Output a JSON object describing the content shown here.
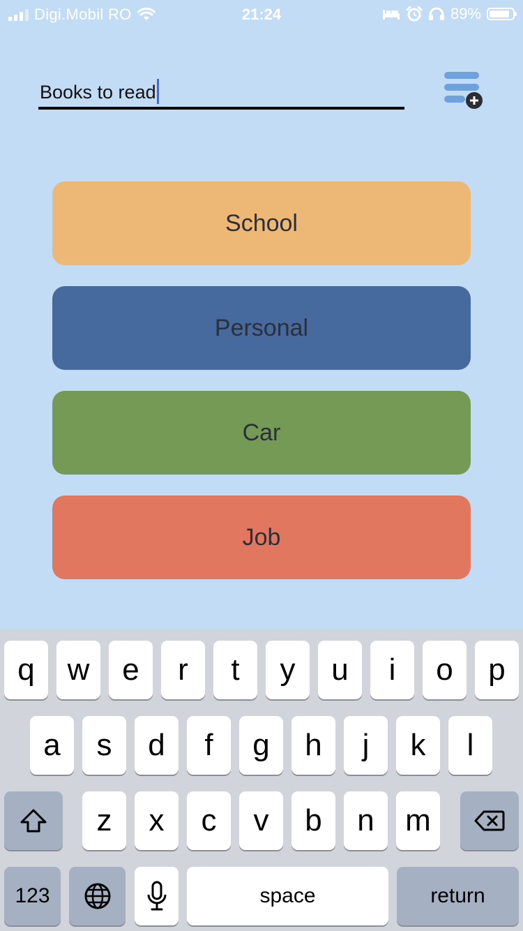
{
  "status_bar": {
    "carrier": "Digi.Mobil RO",
    "time": "21:24",
    "battery": "89%",
    "battery_level": 0.89,
    "icons": [
      "signal-icon",
      "wifi-icon",
      "bed-icon",
      "alarm-icon",
      "headphones-icon",
      "battery-icon"
    ]
  },
  "header": {
    "list_title_value": "Books to read",
    "add_list_icon": "add-list-icon"
  },
  "categories": [
    {
      "label": "School",
      "color": "#edb776"
    },
    {
      "label": "Personal",
      "color": "#476a9e"
    },
    {
      "label": "Car",
      "color": "#759a55"
    },
    {
      "label": "Job",
      "color": "#e2775f"
    }
  ],
  "keyboard": {
    "row1": [
      "q",
      "w",
      "e",
      "r",
      "t",
      "y",
      "u",
      "i",
      "o",
      "p"
    ],
    "row2": [
      "a",
      "s",
      "d",
      "f",
      "g",
      "h",
      "j",
      "k",
      "l"
    ],
    "row3": [
      "z",
      "x",
      "c",
      "v",
      "b",
      "n",
      "m"
    ],
    "shift_icon": "shift-icon",
    "delete_icon": "backspace-icon",
    "numbers_label": "123",
    "globe_icon": "globe-icon",
    "mic_icon": "microphone-icon",
    "space_label": "space",
    "return_label": "return"
  },
  "colors": {
    "background": "#c3dcf5",
    "keyboard_background": "#d1d5db",
    "function_key": "#a5b1c2",
    "caret": "#4a63e0"
  }
}
